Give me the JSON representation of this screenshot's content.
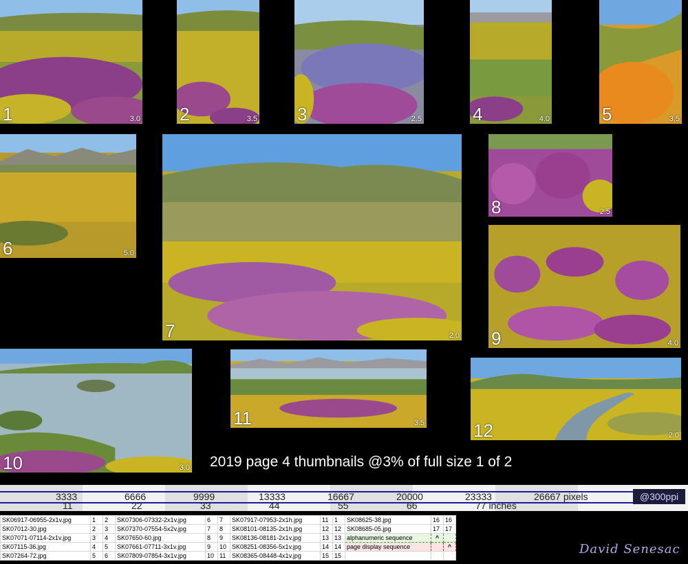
{
  "thumbnails": [
    {
      "number": "1",
      "ratio": "3.0"
    },
    {
      "number": "2",
      "ratio": "3.5"
    },
    {
      "number": "3",
      "ratio": "2.5"
    },
    {
      "number": "4",
      "ratio": "4.0"
    },
    {
      "number": "5",
      "ratio": "3.5"
    },
    {
      "number": "6",
      "ratio": "5.0"
    },
    {
      "number": "7",
      "ratio": "2.0"
    },
    {
      "number": "8",
      "ratio": "2.5"
    },
    {
      "number": "9",
      "ratio": "4.0"
    },
    {
      "number": "10",
      "ratio": "3.0"
    },
    {
      "number": "11",
      "ratio": "3.5"
    },
    {
      "number": "12",
      "ratio": "2.0"
    }
  ],
  "caption": "2019 page 4 thumbnails @3% of full size  1 of 2",
  "ruler": {
    "pixel_ticks": [
      "3333",
      "6666",
      "9999",
      "13333",
      "16667",
      "20000",
      "23333",
      "26667 pixels"
    ],
    "inch_ticks": [
      "11",
      "22",
      "33",
      "44",
      "55",
      "66",
      "77 inches"
    ],
    "ppi": "@300ppi"
  },
  "file_table": {
    "rows": [
      [
        "SK06917-06955-2x1v.jpg",
        "1",
        "2",
        "SK07306-07332-2x1v.jpg",
        "6",
        "7",
        "SK07917-07953-2x1h.jpg",
        "11",
        "1",
        "SK08625-38.jpg",
        "16",
        "16"
      ],
      [
        "SK07012-30.jpg",
        "2",
        "3",
        "SK07370-07554-5x2v.jpg",
        "7",
        "8",
        "SK08101-08135-2x1h.jpg",
        "12",
        "12",
        "SK08685-05.jpg",
        "17",
        "17"
      ],
      [
        "SK07071-07114-2x1v.jpg",
        "3",
        "4",
        "SK07650-60.jpg",
        "8",
        "9",
        "SK08136-08181-2x1v.jpg",
        "13",
        "13",
        "alphanumeric sequence",
        "^",
        ""
      ],
      [
        "SK07115-36.jpg",
        "4",
        "5",
        "SK07661-07711-3x1v.jpg",
        "9",
        "10",
        "SK08251-08356-5x1v.jpg",
        "14",
        "14",
        "page display sequence",
        "",
        "^"
      ],
      [
        "SK07264-72.jpg",
        "5",
        "6",
        "SK07809-07854-3x1v.jpg",
        "10",
        "11",
        "SK08365-08448-4x1v.jpg",
        "15",
        "15",
        "",
        "",
        ""
      ]
    ]
  },
  "signature": "David Senesac",
  "colors": {
    "background": "#000000",
    "sky": "#7fb3e6",
    "goldfields": "#c9b422",
    "owls_clover": "#a04a9a",
    "poppy": "#e88a1e",
    "water": "#9fb8c4",
    "ruler_line": "#1a1aa0"
  }
}
